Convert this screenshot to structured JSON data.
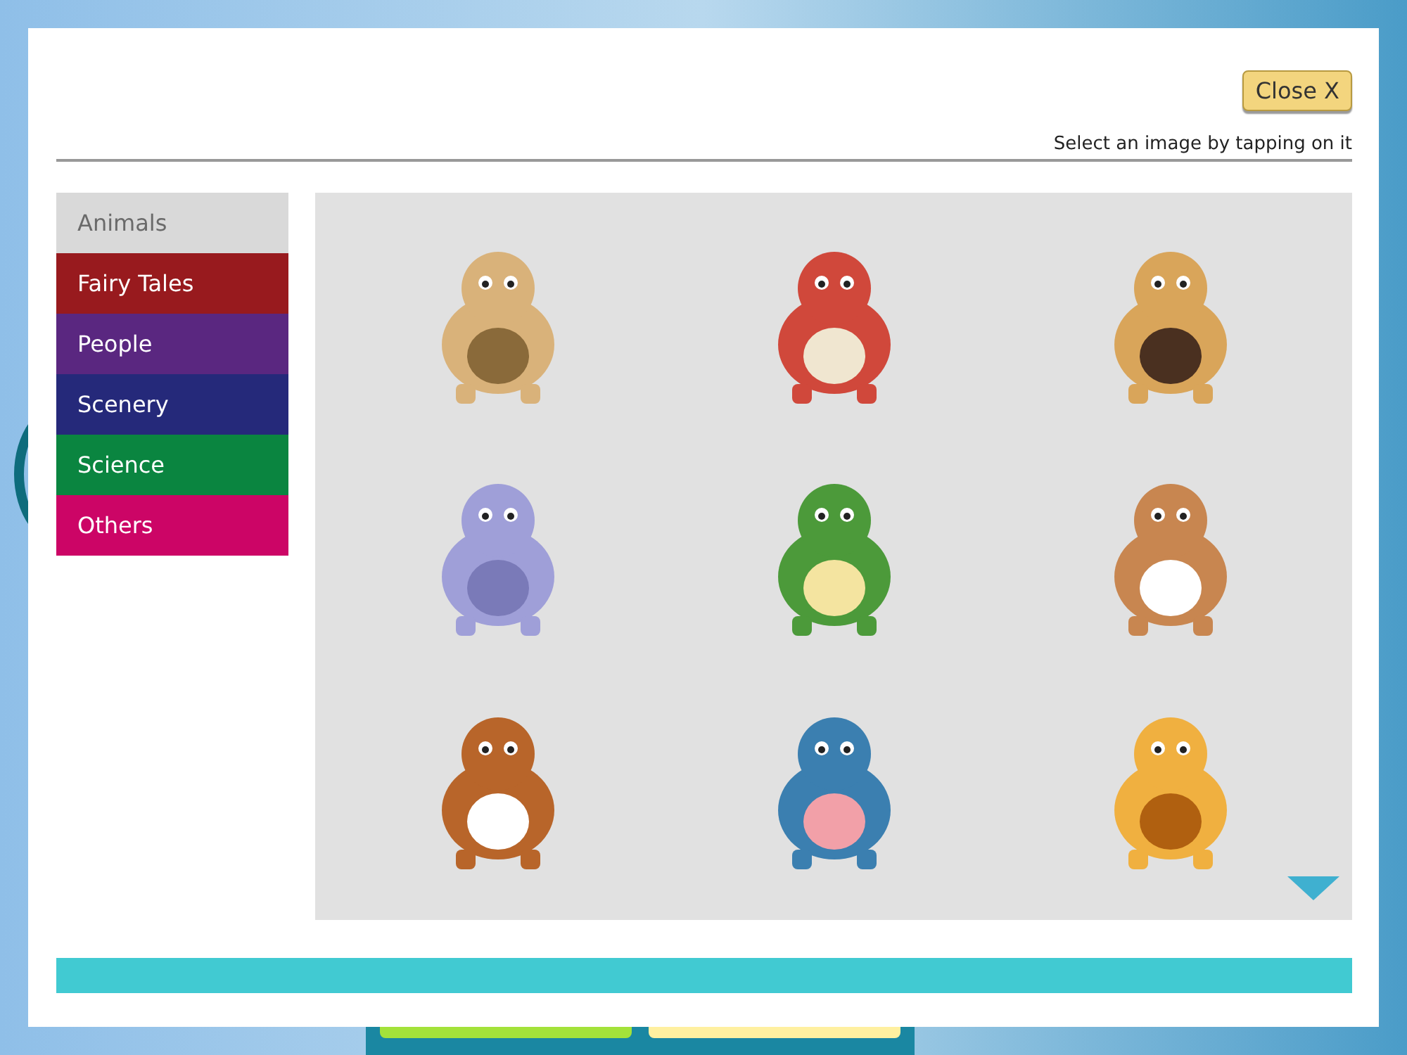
{
  "close_button": {
    "label": "Close X"
  },
  "instruction": "Select an image by tapping on it",
  "categories": [
    {
      "label": "Animals",
      "selected": true
    },
    {
      "label": "Fairy Tales",
      "selected": false,
      "color": "#981a1e"
    },
    {
      "label": "People",
      "selected": false,
      "color": "#5a2780"
    },
    {
      "label": "Scenery",
      "selected": false,
      "color": "#25297a"
    },
    {
      "label": "Science",
      "selected": false,
      "color": "#0a8540"
    },
    {
      "label": "Others",
      "selected": false,
      "color": "#cc0566"
    }
  ]
}
